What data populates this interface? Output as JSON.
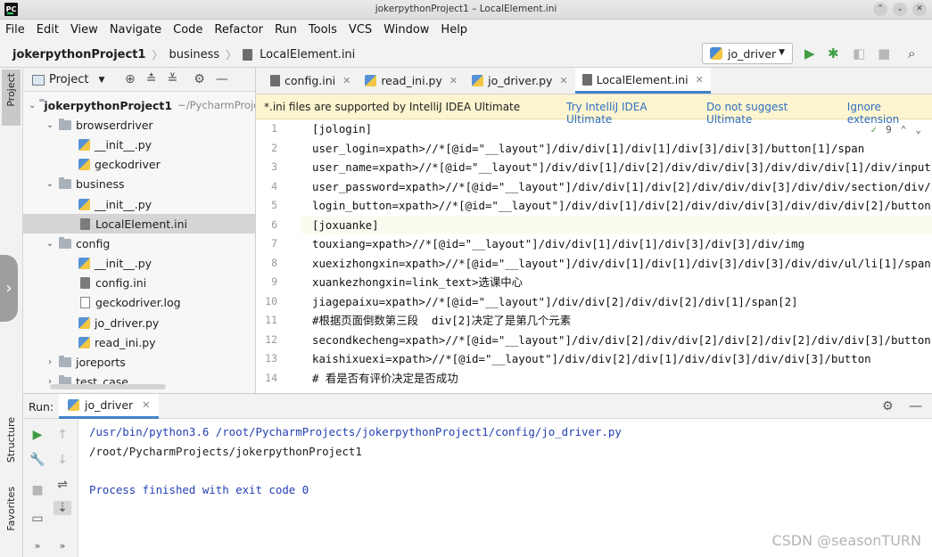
{
  "window": {
    "title": "jokerpythonProject1 – LocalElement.ini",
    "logo_text": "PC",
    "controls": [
      "⌃",
      "⌄",
      "✕"
    ]
  },
  "menu": [
    "File",
    "Edit",
    "View",
    "Navigate",
    "Code",
    "Refactor",
    "Run",
    "Tools",
    "VCS",
    "Window",
    "Help"
  ],
  "breadcrumb": {
    "project": "jokerpythonProject1",
    "folder": "business",
    "file": "LocalElement.ini"
  },
  "run_config": {
    "name": "jo_driver"
  },
  "left_strip": {
    "project_tab": "Project",
    "structure_tab": "Structure",
    "favorites_tab": "Favorites"
  },
  "project_panel": {
    "title": "Project",
    "root_name": "jokerpythonProject1",
    "root_path": "~/PycharmProjects/jokerpythonProject1",
    "items": [
      {
        "label": "browserdriver",
        "type": "folder",
        "expanded": true
      },
      {
        "label": "__init__.py",
        "type": "py"
      },
      {
        "label": "geckodriver",
        "type": "py"
      },
      {
        "label": "business",
        "type": "folder",
        "expanded": true
      },
      {
        "label": "__init__.py",
        "type": "py"
      },
      {
        "label": "LocalElement.ini",
        "type": "ini",
        "selected": true
      },
      {
        "label": "config",
        "type": "folder",
        "expanded": true
      },
      {
        "label": "__init__.py",
        "type": "py"
      },
      {
        "label": "config.ini",
        "type": "ini"
      },
      {
        "label": "geckodriver.log",
        "type": "log"
      },
      {
        "label": "jo_driver.py",
        "type": "py"
      },
      {
        "label": "read_ini.py",
        "type": "py"
      },
      {
        "label": "joreports",
        "type": "folder",
        "expanded": false
      },
      {
        "label": "test_case",
        "type": "folder",
        "expanded": false
      }
    ]
  },
  "tabs": [
    {
      "label": "config.ini",
      "type": "ini",
      "active": false
    },
    {
      "label": "read_ini.py",
      "type": "py",
      "active": false
    },
    {
      "label": "jo_driver.py",
      "type": "py",
      "active": false
    },
    {
      "label": "LocalElement.ini",
      "type": "ini",
      "active": true
    }
  ],
  "banner": {
    "message": "*.ini files are supported by IntelliJ IDEA Ultimate",
    "try_link": "Try IntelliJ IDEA Ultimate",
    "dont_suggest_link": "Do not suggest Ultimate",
    "ignore_link": "Ignore extension"
  },
  "inspection": {
    "count": "9"
  },
  "code_lines": [
    "[jologin]",
    "user_login=xpath>//*[@id=\"__layout\"]/div/div[1]/div[1]/div[3]/div[3]/button[1]/span",
    "user_name=xpath>//*[@id=\"__layout\"]/div/div[1]/div[2]/div/div/div[3]/div/div/div[1]/div/input",
    "user_password=xpath>//*[@id=\"__layout\"]/div/div[1]/div[2]/div/div/div[3]/div/div/section/div/",
    "login_button=xpath>//*[@id=\"__layout\"]/div/div[1]/div[2]/div/div/div[3]/div/div/div[2]/button",
    "[joxuanke]",
    "touxiang=xpath>//*[@id=\"__layout\"]/div/div[1]/div[1]/div[3]/div[3]/div/img",
    "xuexizhongxin=xpath>//*[@id=\"__layout\"]/div/div[1]/div[1]/div[3]/div[3]/div/div/ul/li[1]/span",
    "xuankezhongxin=link_text>选课中心",
    "jiagepaixu=xpath>//*[@id=\"__layout\"]/div/div[2]/div/div[2]/div[1]/span[2]",
    "#根据页面倒数第三段  div[2]决定了是第几个元素",
    "secondkecheng=xpath>//*[@id=\"__layout\"]/div/div[2]/div/div[2]/div[2]/div[2]/div/div[3]/button",
    "kaishixuexi=xpath>//*[@id=\"__layout\"]/div/div[2]/div[1]/div/div[3]/div/div[3]/button",
    "# 看是否有评价决定是否成功"
  ],
  "line_numbers": [
    "1",
    "2",
    "3",
    "4",
    "5",
    "6",
    "7",
    "8",
    "9",
    "10",
    "11",
    "12",
    "13",
    "14"
  ],
  "run_panel": {
    "label": "Run:",
    "tab": "jo_driver",
    "output": [
      "/usr/bin/python3.6 /root/PycharmProjects/jokerpythonProject1/config/jo_driver.py",
      "/root/PycharmProjects/jokerpythonProject1",
      "",
      "Process finished with exit code 0"
    ]
  },
  "watermark": "CSDN @seasonTURN",
  "colors": {
    "accent": "#4083c9",
    "link": "#2e6fc1",
    "run_green": "#3f9d45",
    "banner_bg": "#fdf5d0",
    "console_blue": "#2440b3"
  }
}
